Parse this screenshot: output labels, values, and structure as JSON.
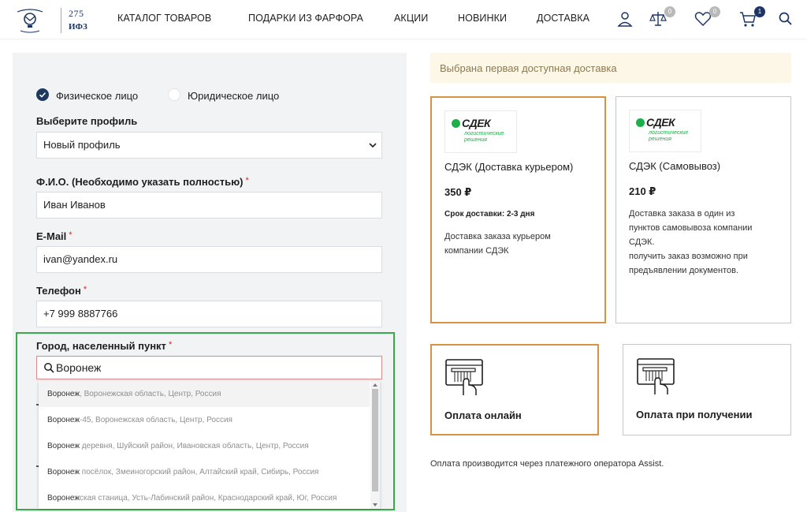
{
  "header": {
    "logo_number": "275",
    "logo_abbr": "ИФЗ",
    "nav": [
      "КАТАЛОГ ТОВАРОВ",
      "ПОДАРКИ ИЗ ФАРФОРА",
      "АКЦИИ",
      "НОВИНКИ",
      "ДОСТАВКА"
    ],
    "compare_count": "0",
    "favorites_count": "0",
    "cart_count": "1",
    "colors": {
      "badge_gray": "#b9b9b9",
      "badge_navy": "#1d3566"
    }
  },
  "form": {
    "person_types": [
      "Физическое лицо",
      "Юридическое лицо"
    ],
    "profile_label": "Выберите профиль",
    "profile_value": "Новый профиль",
    "fio_label": "Ф.И.О. (Необходимо указать полностью)",
    "fio_value": "Иван Иванов",
    "email_label": "E-Mail",
    "email_value": "ivan@yandex.ru",
    "phone_label": "Телефон",
    "phone_value": "+7 999 8887766",
    "city_label": "Город, населенный пункт",
    "city_value": "Воронеж",
    "required_mark": "*",
    "suggestions": [
      {
        "match": "Воронеж",
        "rest": ", Воронежская область, Центр, Россия"
      },
      {
        "match": "Воронеж",
        "rest": "-45, Воронежская область, Центр, Россия"
      },
      {
        "match": "Воронеж",
        "rest": " деревня, Шуйский район, Ивановская область, Центр, Россия"
      },
      {
        "match": "Воронеж",
        "rest": " посёлок, Змеиногорский район, Алтайский край, Сибирь, Россия"
      },
      {
        "match": "Воронеж",
        "rest": "ская станица, Усть-Лабинский район, Краснодарский край, Юг, Россия"
      }
    ]
  },
  "delivery": {
    "notice": "Выбрана первая доступная доставка",
    "logo_word": "СДЕК",
    "logo_sub_1": "логистические",
    "logo_sub_2": "решения",
    "options": [
      {
        "title": "СДЭК (Доставка курьером)",
        "price": "350 ₽",
        "term": "Срок доставки: 2-3 дня",
        "desc": "Доставка заказа курьером\nкомпании СДЭК"
      },
      {
        "title": "СДЭК (Самовывоз)",
        "price": "210 ₽",
        "desc": "Доставка заказа в один из\nпунктов самовывоза компании\nСДЭК.\n получить заказ возможно при\nпредъявлении документов."
      }
    ]
  },
  "payment": {
    "options": [
      "Оплата онлайн",
      "Оплата при получении"
    ],
    "note": "Оплата производится через платежного оператора Assist."
  }
}
